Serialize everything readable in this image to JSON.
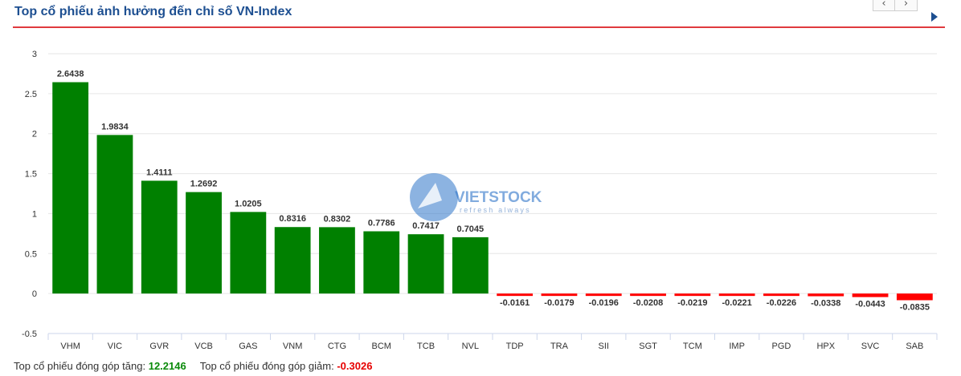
{
  "header": {
    "title": "Top cổ phiếu ảnh hưởng đến chỉ số VN-Index",
    "prev_icon": "‹",
    "next_icon": "›"
  },
  "colors": {
    "title": "#1d4f91",
    "rule": "#e03a3e",
    "positive": "#008000",
    "negative": "#ff0000"
  },
  "chart_data": {
    "type": "bar",
    "categories": [
      "VHM",
      "VIC",
      "GVR",
      "VCB",
      "GAS",
      "VNM",
      "CTG",
      "BCM",
      "TCB",
      "NVL",
      "TDP",
      "TRA",
      "SII",
      "SGT",
      "TCM",
      "IMP",
      "PGD",
      "HPX",
      "SVC",
      "SAB"
    ],
    "values": [
      2.6438,
      1.9834,
      1.4111,
      1.2692,
      1.0205,
      0.8316,
      0.8302,
      0.7786,
      0.7417,
      0.7045,
      -0.0161,
      -0.0179,
      -0.0196,
      -0.0208,
      -0.0219,
      -0.0221,
      -0.0226,
      -0.0338,
      -0.0443,
      -0.0835
    ],
    "data_labels": [
      "2.6438",
      "1.9834",
      "1.4111",
      "1.2692",
      "1.0205",
      "0.8316",
      "0.8302",
      "0.7786",
      "0.7417",
      "0.7045",
      "-0.0161",
      "-0.0179",
      "-0.0196",
      "-0.0208",
      "-0.0219",
      "-0.0221",
      "-0.0226",
      "-0.0338",
      "-0.0443",
      "-0.0835"
    ],
    "ylim": [
      -0.5,
      3
    ],
    "yticks": [
      "3",
      "2.5",
      "2",
      "1.5",
      "1",
      "0.5",
      "0",
      "-0.5"
    ],
    "grid": true,
    "watermark_text": "VIETSTOCK",
    "watermark_tagline": "refresh always"
  },
  "footer": {
    "gain_label": "Top cổ phiếu đóng góp tăng:",
    "gain_value": "12.2146",
    "loss_label": "Top cổ phiếu đóng góp giảm:",
    "loss_value": "-0.3026"
  }
}
